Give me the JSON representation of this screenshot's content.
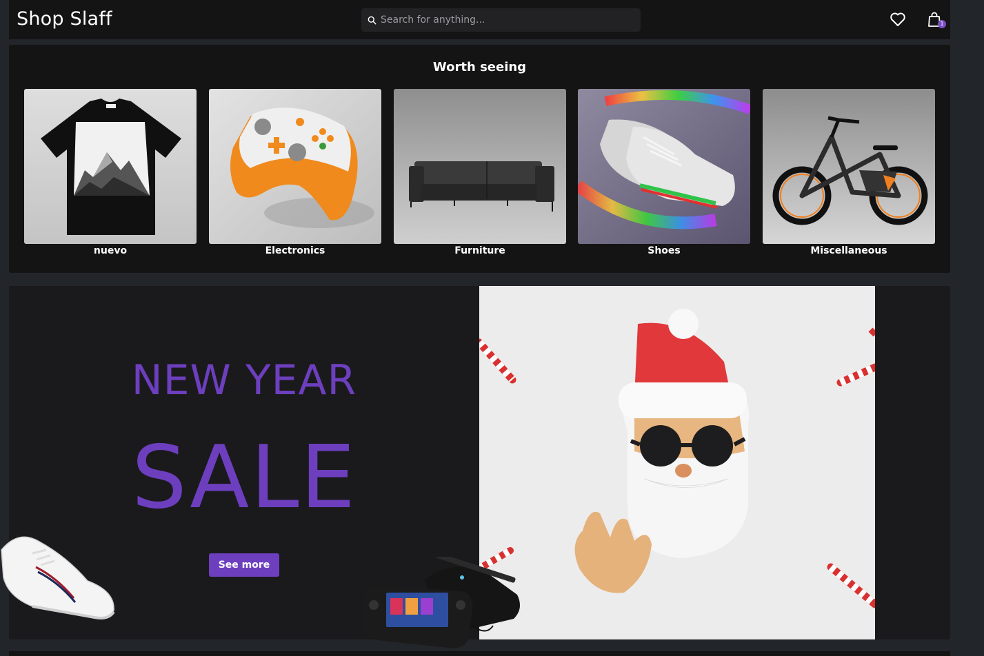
{
  "header": {
    "brand": "Shop Slaff",
    "search_placeholder": "Search for anything...",
    "cart_count": "1",
    "icons": [
      "search-icon",
      "heart-icon",
      "bag-icon"
    ]
  },
  "worth_seeing": {
    "title": "Worth seeing",
    "categories": [
      {
        "label": "nuevo"
      },
      {
        "label": "Electronics"
      },
      {
        "label": "Furniture"
      },
      {
        "label": "Shoes"
      },
      {
        "label": "Miscellaneous"
      }
    ]
  },
  "banner": {
    "line1": "NEW YEAR",
    "line2": "SALE",
    "button": "See more"
  },
  "colors": {
    "accent": "#6d3fbf",
    "panel": "#141414",
    "background": "#22252a"
  }
}
